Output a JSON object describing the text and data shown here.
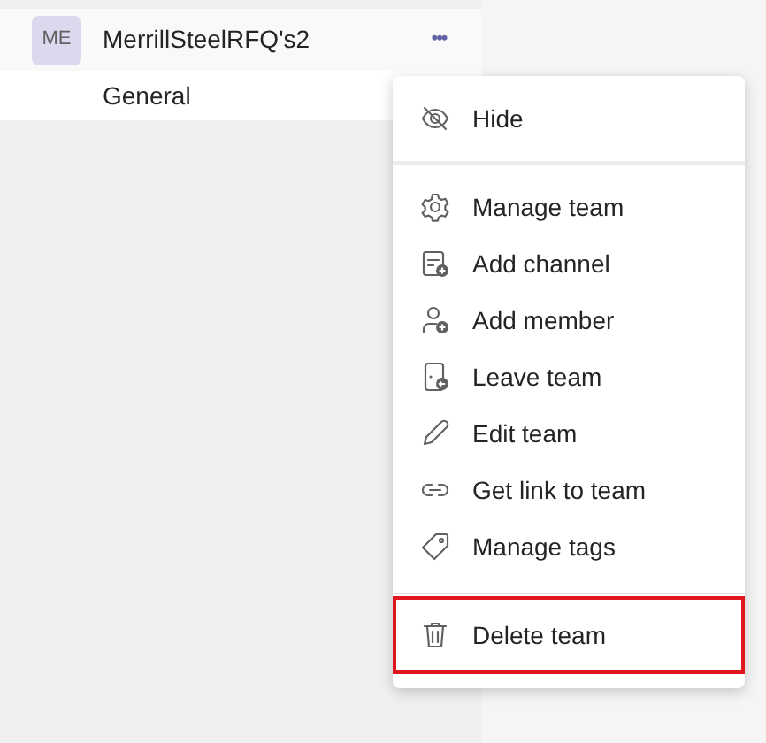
{
  "team": {
    "avatar": "ME",
    "name": "MerrillSteelRFQ's2",
    "more": "•••",
    "channels": [
      {
        "name": "General"
      }
    ]
  },
  "menu": {
    "sections": [
      [
        {
          "label": "Hide",
          "highlighted": false
        }
      ],
      [
        {
          "label": "Manage team",
          "highlighted": false
        },
        {
          "label": "Add channel",
          "highlighted": false
        },
        {
          "label": "Add member",
          "highlighted": false
        },
        {
          "label": "Leave team",
          "highlighted": false
        },
        {
          "label": "Edit team",
          "highlighted": false
        },
        {
          "label": "Get link to team",
          "highlighted": false
        },
        {
          "label": "Manage tags",
          "highlighted": false
        }
      ],
      [
        {
          "label": "Delete team",
          "highlighted": true
        }
      ]
    ]
  }
}
